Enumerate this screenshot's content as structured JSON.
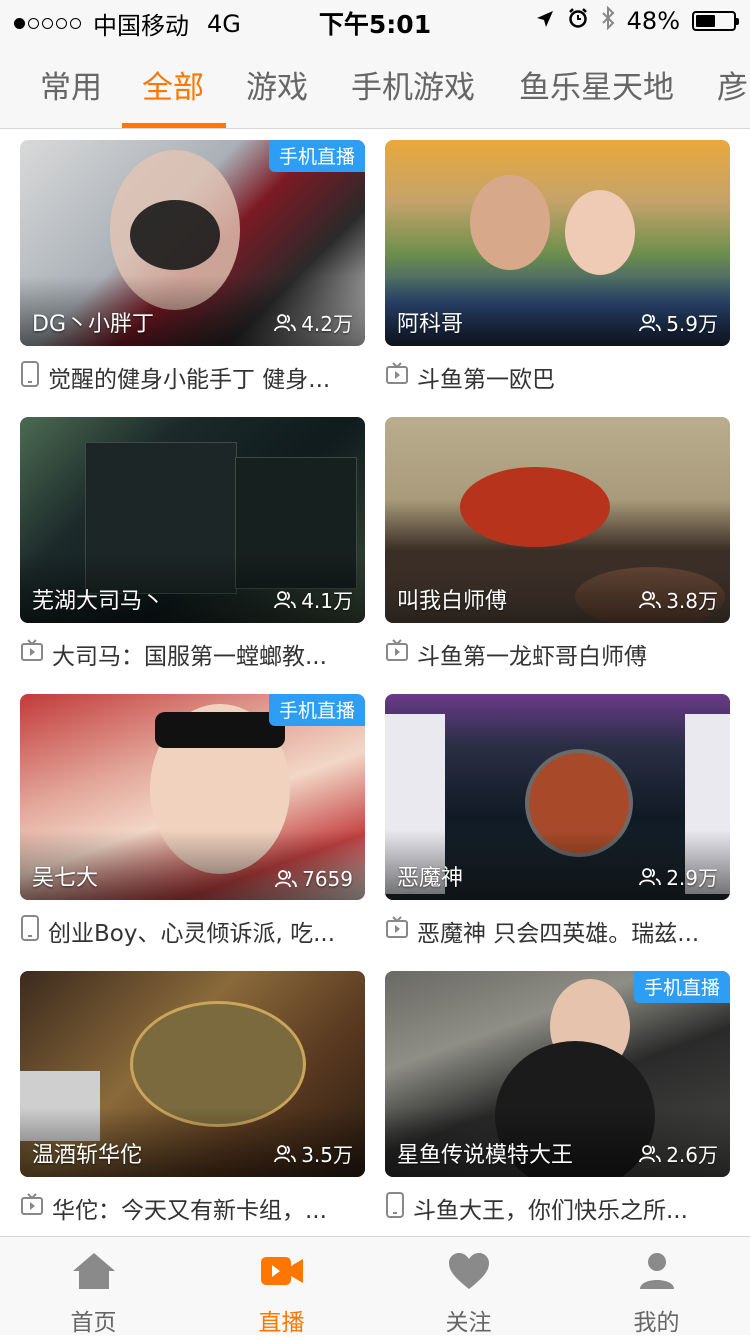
{
  "status_bar": {
    "signal_dots": 5,
    "signal_filled": 1,
    "carrier": "中国移动",
    "network": "4G",
    "time": "下午5:01",
    "battery_text": "48%",
    "battery_level": 0.48,
    "icons": [
      "location-icon",
      "alarm-icon",
      "bluetooth-icon",
      "battery-icon"
    ]
  },
  "tabs": [
    {
      "label": "常用",
      "active": false
    },
    {
      "label": "全部",
      "active": true
    },
    {
      "label": "游戏",
      "active": false
    },
    {
      "label": "手机游戏",
      "active": false
    },
    {
      "label": "鱼乐星天地",
      "active": false
    },
    {
      "label": "彦",
      "active": false
    }
  ],
  "accent_color": "#ff7700",
  "badge_color": "#2e9ef4",
  "streams": [
    {
      "anchor": "DG丶小胖丁",
      "viewers": "4.2万",
      "badge": "手机直播",
      "title": "觉醒的健身小能手丁 健身...",
      "device_icon": "phone-icon"
    },
    {
      "anchor": "阿科哥",
      "viewers": "5.9万",
      "badge": "",
      "title": "斗鱼第一欧巴",
      "device_icon": "tv-icon"
    },
    {
      "anchor": "芜湖大司马丶",
      "viewers": "4.1万",
      "badge": "",
      "title": "大司马：国服第一螳螂教...",
      "device_icon": "tv-icon"
    },
    {
      "anchor": "叫我白师傅",
      "viewers": "3.8万",
      "badge": "",
      "title": "斗鱼第一龙虾哥白师傅",
      "device_icon": "tv-icon"
    },
    {
      "anchor": "吴七大",
      "viewers": "7659",
      "badge": "手机直播",
      "title": "创业Boy、心灵倾诉派, 吃...",
      "device_icon": "phone-icon"
    },
    {
      "anchor": "恶魔神",
      "viewers": "2.9万",
      "badge": "",
      "title": "恶魔神 只会四英雄。瑞兹...",
      "device_icon": "tv-icon"
    },
    {
      "anchor": "温酒斩华佗",
      "viewers": "3.5万",
      "badge": "",
      "title": "华佗：今天又有新卡组，...",
      "device_icon": "tv-icon"
    },
    {
      "anchor": "星鱼传说模特大王",
      "viewers": "2.6万",
      "badge": "手机直播",
      "title": "斗鱼大王，你们快乐之所...",
      "device_icon": "phone-icon"
    }
  ],
  "bottom_nav": [
    {
      "label": "首页",
      "icon": "home-icon",
      "active": false
    },
    {
      "label": "直播",
      "icon": "video-camera-icon",
      "active": true
    },
    {
      "label": "关注",
      "icon": "heart-icon",
      "active": false
    },
    {
      "label": "我的",
      "icon": "user-icon",
      "active": false
    }
  ]
}
